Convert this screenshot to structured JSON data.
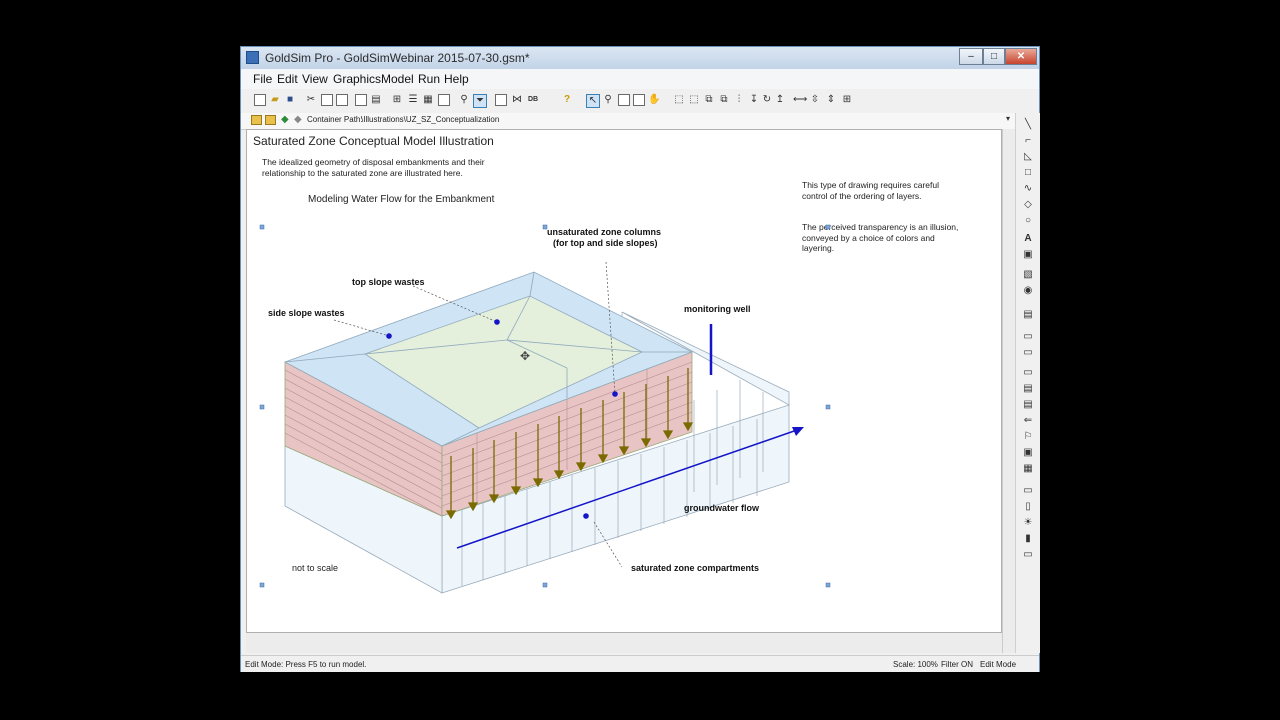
{
  "window": {
    "title": "GoldSim Pro - GoldSimWebinar 2015-07-30.gsm*",
    "controls": {
      "minimize": "‒",
      "maximize": "□",
      "close": "✕"
    }
  },
  "menu": [
    "File",
    "Edit",
    "View",
    "Graphics",
    "Model",
    "Run",
    "Help"
  ],
  "path": {
    "label": "Container Path:",
    "value": "\\Illustrations\\UZ_SZ_Conceptualization"
  },
  "canvas": {
    "title": "Saturated Zone Conceptual Model Illustration",
    "description": "The idealized geometry of disposal embankments and their relationship to the saturated zone are illustrated here.",
    "subtitle": "Modeling Water Flow for the Embankment",
    "note1": "This type of drawing requires careful control of the ordering of layers.",
    "note2": "The perceived transparency is an illusion, conveyed by a choice of colors and layering.",
    "labels": {
      "uz_columns_1": "unsaturated zone columns",
      "uz_columns_2": "(for top and side slopes)",
      "top_slope": "top slope wastes",
      "side_slope": "side slope wastes",
      "monitoring_well": "monitoring well",
      "groundwater_flow": "groundwater flow",
      "sz_compartments": "saturated zone compartments",
      "not_to_scale": "not to scale"
    },
    "colors": {
      "top_fill": "#e4efdc",
      "slope_fill": "#cfe4f4",
      "waste_fill": "#e8c4c4",
      "arrow": "#7a6a00",
      "flow": "#1414c8"
    }
  },
  "status": {
    "mode": "Edit Mode: Press F5 to run model.",
    "scale": "Scale: 100%",
    "filter": "Filter ON",
    "edit": "Edit Mode"
  }
}
